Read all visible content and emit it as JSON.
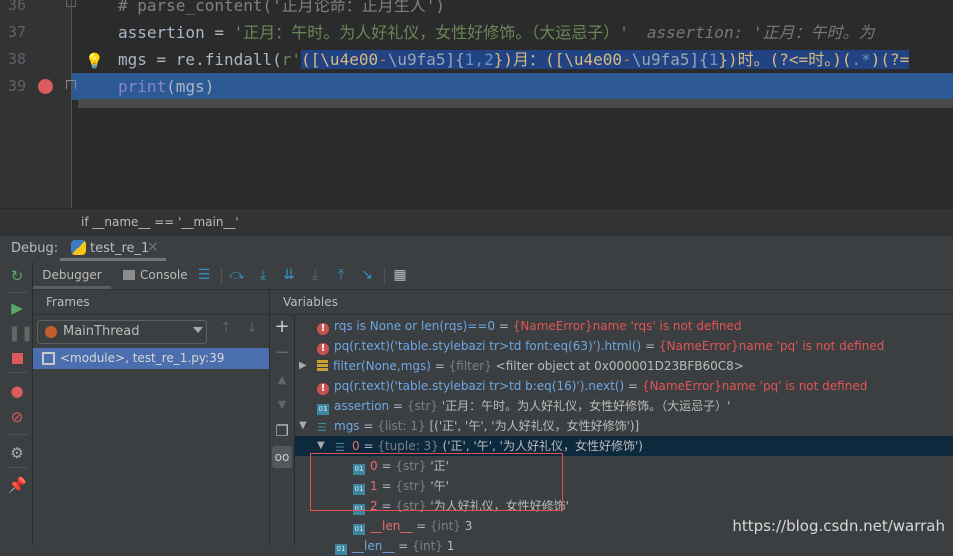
{
  "editor": {
    "lines": [
      {
        "number": "36",
        "text": "# parse_content('正月论命：正月生人')"
      },
      {
        "number": "37",
        "code_id": "assertion = ",
        "code_str": "'正月：午时。为人好礼仪，女性好修饰。（大运忌子）'",
        "hint": "assertion: '正月：午时。为"
      },
      {
        "number": "38",
        "code_prefix": "mgs = re.findall(",
        "code_r": "r'",
        "regex_parts": [
          "([\\u4e00",
          "-",
          "\\u9fa5]{",
          "1,2",
          "})月：([\\u4e00",
          "-",
          "\\u9fa5]{",
          "1",
          "})时。(?<=时。)(",
          ".*",
          ")(?="
        ]
      },
      {
        "number": "39",
        "code_print": "print",
        "code_args": "(mgs)"
      }
    ],
    "breadcrumb": "if __name__ == '__main__'"
  },
  "debug": {
    "label": "Debug:",
    "tab_label": "test_re_1",
    "tabs": {
      "debugger": "Debugger",
      "console": "Console"
    }
  },
  "frames": {
    "title": "Frames",
    "thread": "MainThread",
    "frame_item": "<module>, test_re_1.py:39"
  },
  "variables": {
    "title": "Variables",
    "rows": [
      {
        "icon": "error",
        "name": "rqs is None or len(rqs)==0",
        "eq": " = ",
        "type": "",
        "value": "{NameError}name 'rqs' is not defined"
      },
      {
        "icon": "error",
        "name": "pq(r.text)('table.stylebazi tr>td font:eq(63)').html()",
        "eq": " = ",
        "type": "",
        "value": "{NameError}name 'pq' is not defined"
      },
      {
        "icon": "filter",
        "name": "filter(None,mgs)",
        "eq": " = ",
        "type": "{filter}",
        "value": " <filter object at 0x000001D23BFB60C8>"
      },
      {
        "icon": "error",
        "name": "pq(r.text)('table.stylebazi tr>td b:eq(16)').next()",
        "eq": " = ",
        "type": "",
        "value": "{NameError}name 'pq' is not defined"
      },
      {
        "icon": "str",
        "name": "assertion",
        "eq": " = ",
        "type": "{str}",
        "value": " '正月：午时。为人好礼仪，女性好修饰。（大运忌子）'"
      },
      {
        "icon": "list",
        "name": "mgs",
        "eq": " = ",
        "type": "{list: 1}",
        "value": " [('正', '午', '为人好礼仪，女性好修饰')]"
      },
      {
        "icon": "list",
        "name": "0",
        "eq": " = ",
        "type": "{tuple: 3}",
        "value": " ('正', '午', '为人好礼仪，女性好修饰')"
      },
      {
        "icon": "str",
        "name": "0",
        "eq": " = ",
        "type": "{str}",
        "value": " '正'"
      },
      {
        "icon": "str",
        "name": "1",
        "eq": " = ",
        "type": "{str}",
        "value": " '午'"
      },
      {
        "icon": "str",
        "name": "2",
        "eq": " = ",
        "type": "{str}",
        "value": " '为人好礼仪，女性好修饰'"
      },
      {
        "icon": "str",
        "name": "__len__",
        "eq": " = ",
        "type": "{int}",
        "value": " 3"
      },
      {
        "icon": "str",
        "name": "__len__",
        "eq": " = ",
        "type": "{int}",
        "value": " 1"
      }
    ]
  },
  "watermark": "https://blog.csdn.net/warrah"
}
